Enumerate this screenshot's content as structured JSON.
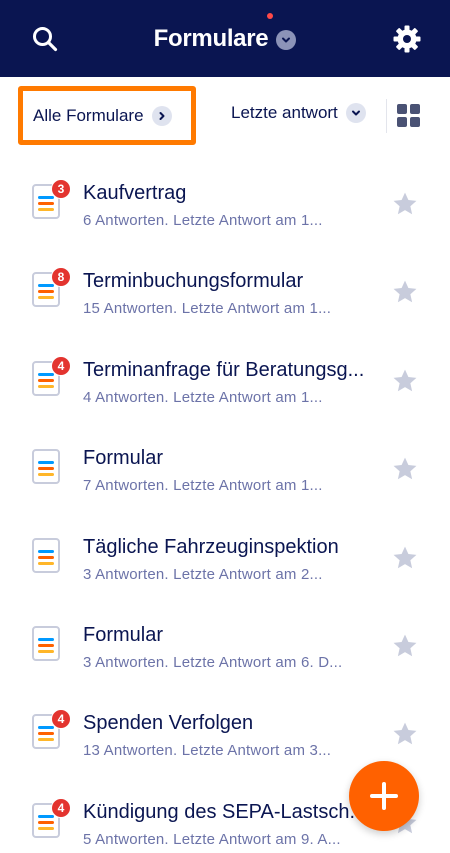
{
  "header": {
    "title": "Formulare",
    "search_icon": "search-icon",
    "settings_icon": "gear-icon",
    "notification_dot_color": "#ff4948",
    "background_color": "#0a1551"
  },
  "filter_bar": {
    "all_forms_label": "Alle Formulare",
    "sort_label": "Letzte antwort",
    "view_icon": "grid-view-icon"
  },
  "forms": [
    {
      "title": "Kaufvertrag",
      "subtitle": "6 Antworten. Letzte Antwort am 1...",
      "badge": "3"
    },
    {
      "title": "Terminbuchungsformular",
      "subtitle": "15 Antworten. Letzte Antwort am 1...",
      "badge": "8"
    },
    {
      "title": "Terminanfrage für Beratungsg...",
      "subtitle": "4 Antworten. Letzte Antwort am 1...",
      "badge": "4"
    },
    {
      "title": "Formular",
      "subtitle": "7 Antworten. Letzte Antwort am 1...",
      "badge": ""
    },
    {
      "title": "Tägliche Fahrzeuginspektion",
      "subtitle": "3 Antworten. Letzte Antwort am 2...",
      "badge": ""
    },
    {
      "title": "Formular",
      "subtitle": "3 Antworten. Letzte Antwort am 6. D...",
      "badge": ""
    },
    {
      "title": "Spenden Verfolgen",
      "subtitle": "13 Antworten. Letzte Antwort am 3...",
      "badge": "4"
    },
    {
      "title": "Kündigung des SEPA-Lastsch...",
      "subtitle": "5 Antworten. Letzte Antwort am 9. A...",
      "badge": "4"
    }
  ],
  "fab_icon": "plus-icon",
  "colors": {
    "accent": "#ff6100",
    "highlight_border": "#ff7a00",
    "badge": "#e3342f",
    "star": "#c8ccdc"
  }
}
